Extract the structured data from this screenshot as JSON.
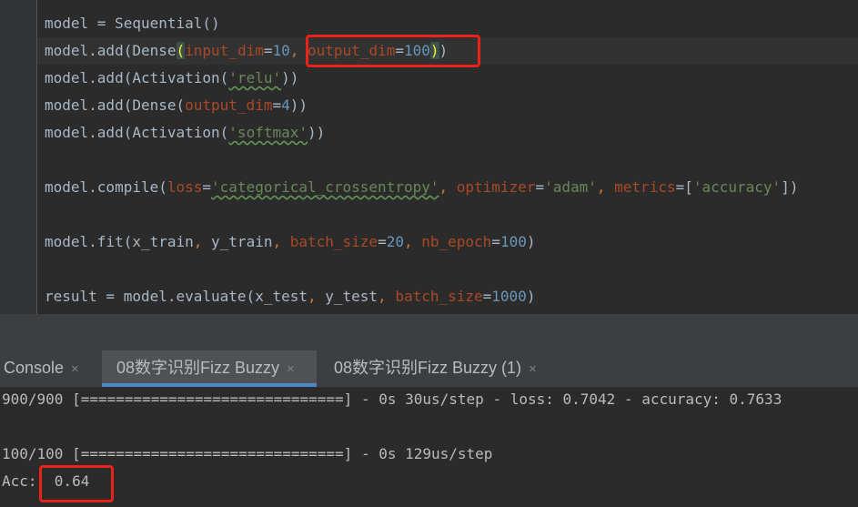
{
  "editor": {
    "line1": {
      "a": "model = Sequential()"
    },
    "line2": {
      "a": "model.add(Dense",
      "b": "(",
      "c": "input_dim",
      "d": "=",
      "e": "10",
      "f": ", ",
      "g": "output_dim",
      "h": "=",
      "i": "100",
      "j": ")",
      "k": ")"
    },
    "line3": {
      "a": "model.add(Activation(",
      "b": "'relu'",
      "c": "))"
    },
    "line4": {
      "a": "model.add(Dense(",
      "b": "output_dim",
      "c": "=",
      "d": "4",
      "e": "))"
    },
    "line5": {
      "a": "model.add(Activation(",
      "b": "'softmax'",
      "c": "))"
    },
    "line6": {
      "a": "model.compile(",
      "b": "loss",
      "c": "=",
      "d": "'categorical_crossentropy'",
      "e": ", ",
      "f": "optimizer",
      "g": "=",
      "h": "'adam'",
      "i": ", ",
      "j": "metrics",
      "k": "=[",
      "l": "'accuracy'",
      "m": "])"
    },
    "line7": {
      "a": "model.fit(x_train",
      "b": ", ",
      "c": "y_train",
      "d": ", ",
      "e": "batch_size",
      "f": "=",
      "g": "20",
      "h": ", ",
      "i": "nb_epoch",
      "j": "=",
      "k": "100",
      "l": ")"
    },
    "line8": {
      "a": "result = model.evaluate(x_test",
      "b": ", ",
      "c": "y_test",
      "d": ", ",
      "e": "batch_size",
      "f": "=",
      "g": "1000",
      "h": ")"
    }
  },
  "tabs": [
    {
      "label": "Console",
      "close": "×"
    },
    {
      "label": "08数字识别Fizz Buzzy",
      "close": "×"
    },
    {
      "label": "08数字识别Fizz Buzzy (1)",
      "close": "×"
    }
  ],
  "console": {
    "out1": "900/900 [==============================] - 0s 30us/step - loss: 0.7042 - accuracy: 0.7633",
    "out2": "100/100 [==============================] - 0s 129us/step",
    "acc_label": "Acc:",
    "acc_value": "0.64"
  },
  "colors": {
    "highlight_box": "#e8231a",
    "active_tab_underline": "#4a88c7"
  }
}
